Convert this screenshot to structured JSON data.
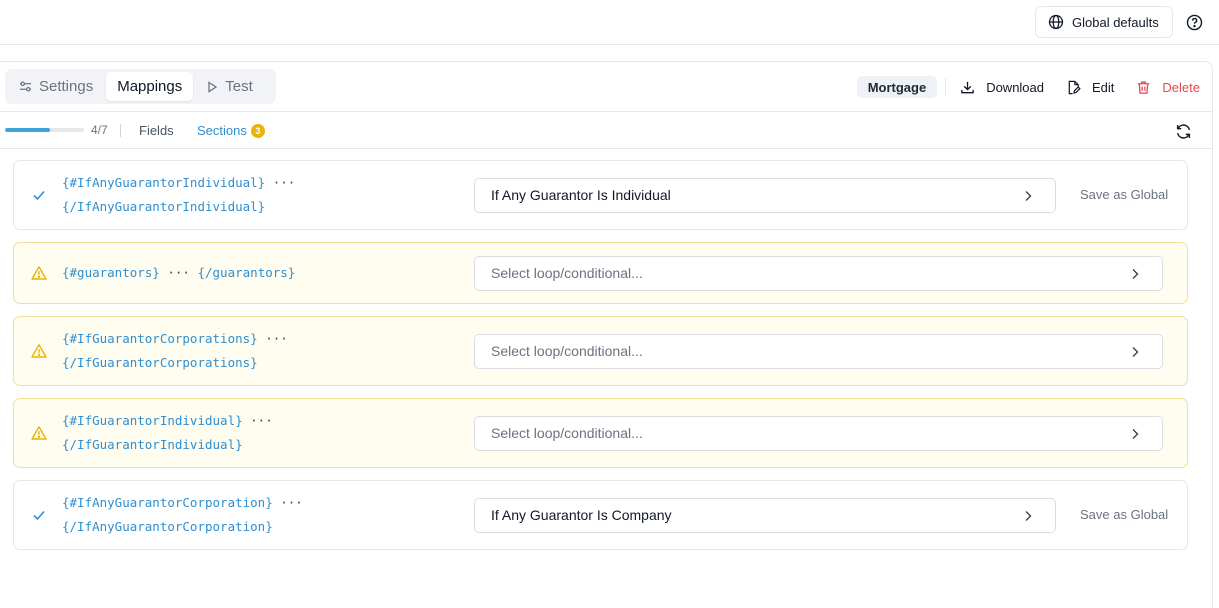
{
  "header": {
    "global_defaults_label": "Global defaults"
  },
  "tabs": [
    {
      "label": "Settings",
      "icon": "sliders-icon",
      "active": false
    },
    {
      "label": "Mappings",
      "icon": "",
      "active": true
    },
    {
      "label": "Test",
      "icon": "play-icon",
      "active": false
    }
  ],
  "actions": {
    "badge": "Mortgage",
    "download_label": "Download",
    "edit_label": "Edit",
    "delete_label": "Delete"
  },
  "progress": {
    "text": "4/7",
    "fraction": 0.57
  },
  "subtabs": {
    "fields_label": "Fields",
    "sections_label": "Sections",
    "sections_count": "3"
  },
  "colors": {
    "accent": "#2f8fd0",
    "warning": "#eab308",
    "danger": "#e5484d",
    "success": "#2f8fd0"
  },
  "sections": [
    {
      "status": "mapped",
      "open_tag": "{#IfAnyGuarantorIndividual}",
      "ellipsis": "···",
      "close_tag": "{/IfAnyGuarantorIndividual}",
      "value": "If Any Guarantor Is Individual",
      "placeholder": "",
      "save_label": "Save as Global"
    },
    {
      "status": "warning",
      "open_tag": "{#guarantors}",
      "ellipsis": "···",
      "close_tag": "{/guarantors}",
      "value": "",
      "placeholder": "Select loop/conditional...",
      "save_label": ""
    },
    {
      "status": "warning",
      "open_tag": "{#IfGuarantorCorporations}",
      "ellipsis": "···",
      "close_tag": "{/IfGuarantorCorporations}",
      "value": "",
      "placeholder": "Select loop/conditional...",
      "save_label": ""
    },
    {
      "status": "warning",
      "open_tag": "{#IfGuarantorIndividual}",
      "ellipsis": "···",
      "close_tag": "{/IfGuarantorIndividual}",
      "value": "",
      "placeholder": "Select loop/conditional...",
      "save_label": ""
    },
    {
      "status": "mapped",
      "open_tag": "{#IfAnyGuarantorCorporation}",
      "ellipsis": "···",
      "close_tag": "{/IfAnyGuarantorCorporation}",
      "value": "If Any Guarantor Is Company",
      "placeholder": "",
      "save_label": "Save as Global"
    }
  ]
}
